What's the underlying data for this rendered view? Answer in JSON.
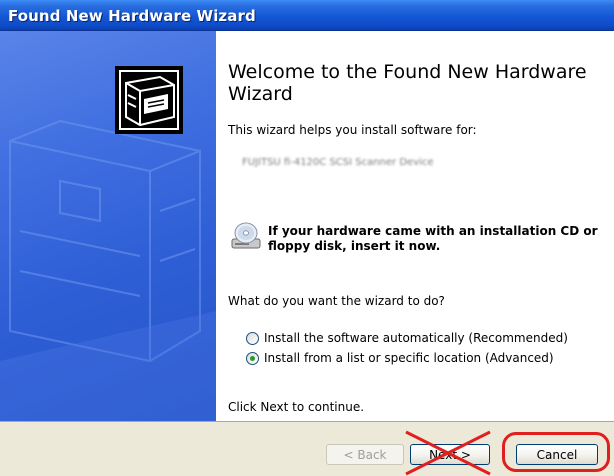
{
  "window": {
    "title": "Found New Hardware Wizard"
  },
  "content": {
    "heading": "Welcome to the Found New Hardware Wizard",
    "intro": "This wizard helps you install software for:",
    "device_name": "FUJITSU fi-4120C SCSI Scanner Device",
    "cd_prompt": "If your hardware came with an installation CD or floppy disk, insert it now.",
    "question": "What do you want the wizard to do?",
    "options": [
      {
        "label": "Install the software automatically (Recommended)",
        "selected": false
      },
      {
        "label": "Install from a list or specific location (Advanced)",
        "selected": true
      }
    ],
    "continue_text": "Click Next to continue."
  },
  "footer": {
    "back_label": "< Back",
    "next_label": "Next >",
    "cancel_label": "Cancel"
  },
  "colors": {
    "titlebar": "#0f4cc8",
    "left_panel": "#2f5fd6",
    "annotation_red": "#e02020"
  },
  "icons": [
    "hardware-card-icon",
    "cd-drive-icon"
  ]
}
